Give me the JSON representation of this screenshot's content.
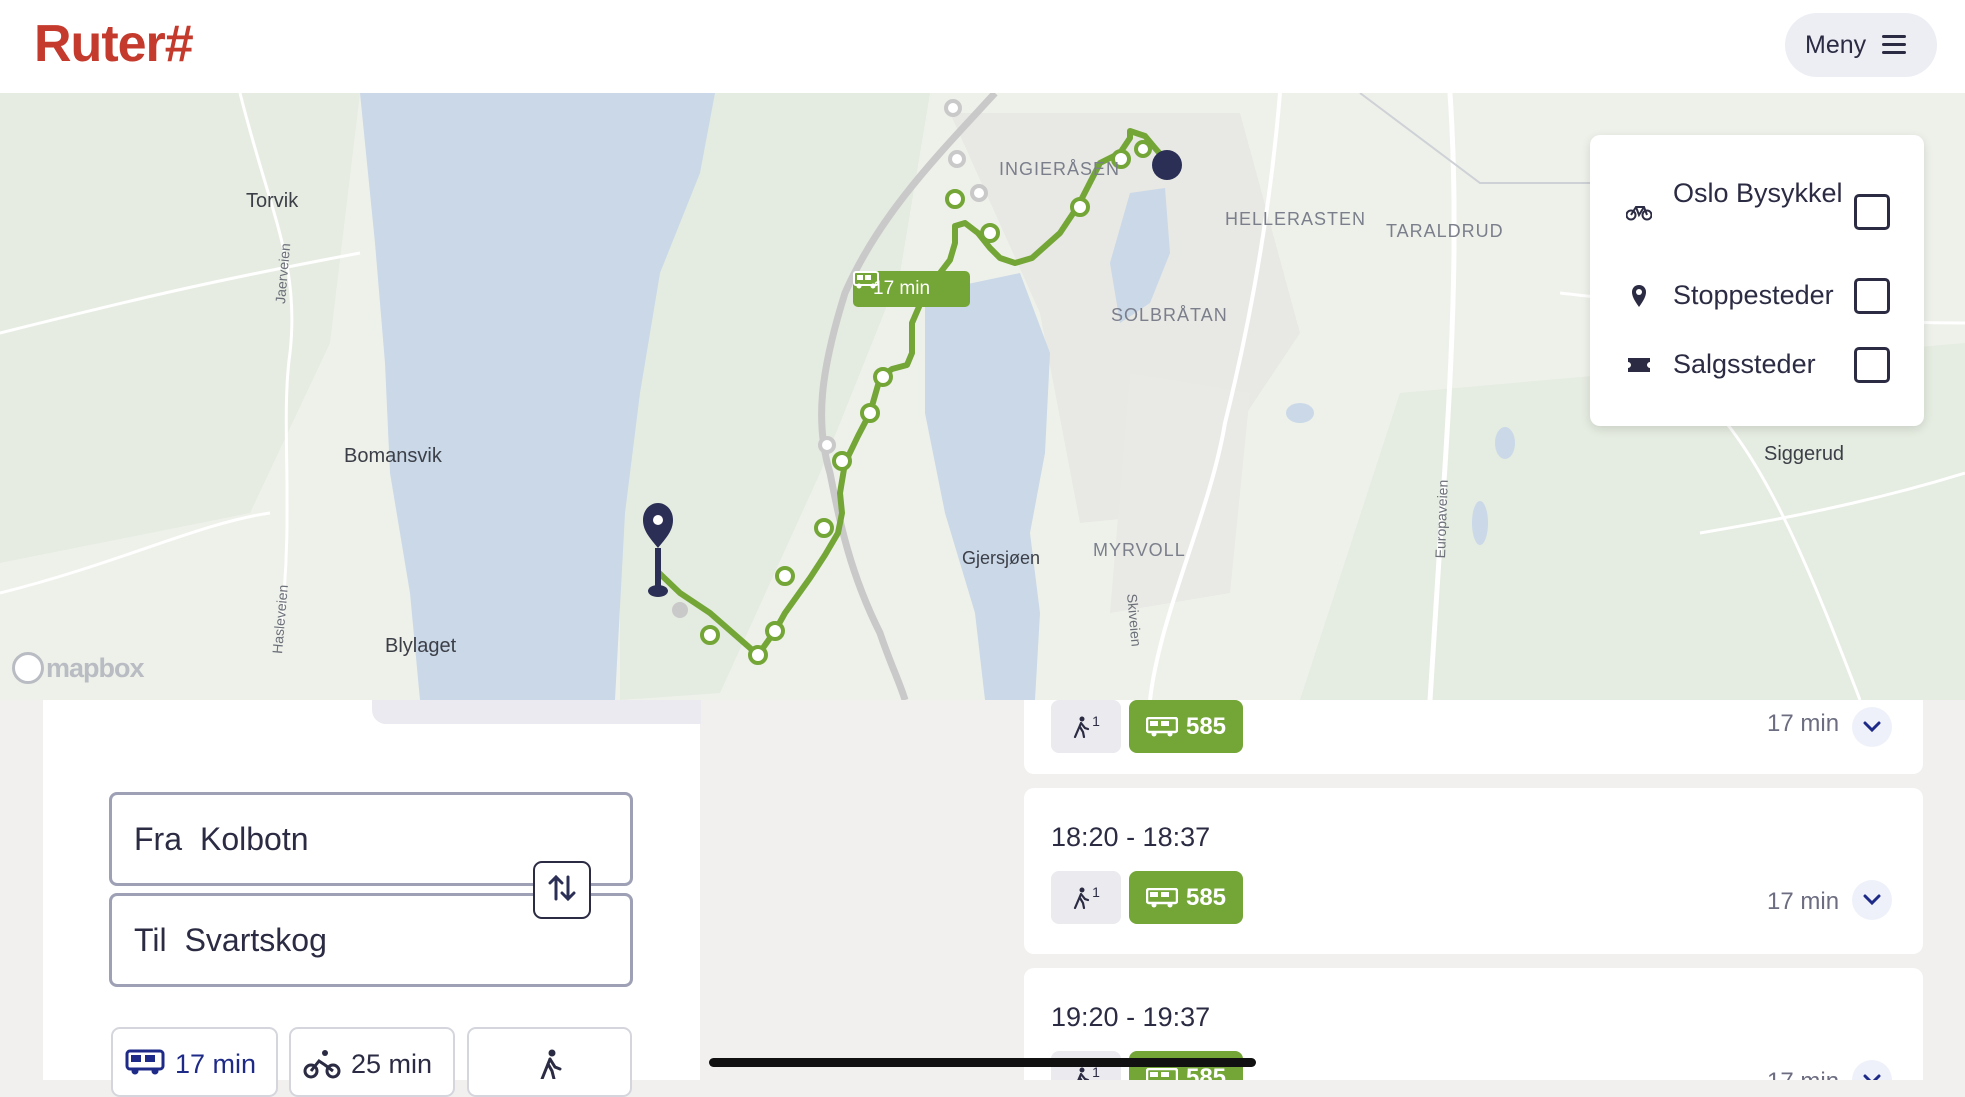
{
  "header": {
    "logo": "Ruter#",
    "menu_label": "Meny"
  },
  "map": {
    "places": [
      "Torvik",
      "Bomansvik",
      "Blylaget",
      "INGIERÅSEN",
      "HELLERASTEN",
      "TARALDRUD",
      "SOLBRÅTAN",
      "MYRVOLL",
      "Gjersjøen",
      "Siggerud"
    ],
    "roads": [
      "Jaerveien",
      "Hasleveien",
      "Skiveien",
      "Europaveien"
    ],
    "route_badge": "17 min",
    "attribution": "mapbox",
    "colors": {
      "route": "#74a637",
      "water": "#cad8e8",
      "land": "#eef1ea"
    }
  },
  "layers": [
    {
      "label": "Oslo Bysykkel",
      "icon": "bicycle-icon",
      "checked": false
    },
    {
      "label": "Stoppesteder",
      "icon": "location-pin-icon",
      "checked": false
    },
    {
      "label": "Salgssteder",
      "icon": "ticket-icon",
      "checked": false
    }
  ],
  "search": {
    "from_prefix": "Fra",
    "from_value": "Kolbotn",
    "to_prefix": "Til",
    "to_value": "Svartskog"
  },
  "modes": [
    {
      "label": "17 min",
      "icon": "bus-icon"
    },
    {
      "label": "25 min",
      "icon": "bicycle-icon"
    },
    {
      "label": "",
      "icon": "walk-icon"
    }
  ],
  "trips": [
    {
      "time": "",
      "walk": "1",
      "line": "585",
      "duration": "17 min"
    },
    {
      "time": "18:20 - 18:37",
      "walk": "1",
      "line": "585",
      "duration": "17 min"
    },
    {
      "time": "19:20 - 19:37",
      "walk": "1",
      "line": "585",
      "duration": "17 min"
    }
  ]
}
